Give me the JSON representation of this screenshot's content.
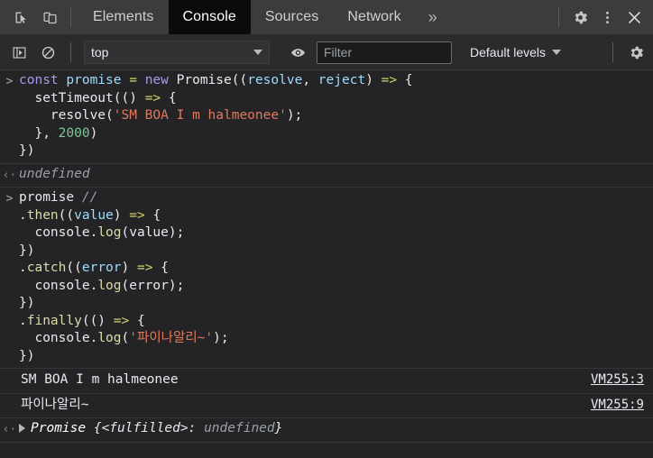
{
  "window": {
    "tabbar": {
      "left_icons": [
        {
          "name": "inspect-element-icon",
          "title": "Inspect element"
        },
        {
          "name": "device-toolbar-icon",
          "title": "Toggle device toolbar"
        }
      ],
      "tabs": [
        {
          "label": "Elements",
          "active": false
        },
        {
          "label": "Console",
          "active": true
        },
        {
          "label": "Sources",
          "active": false
        },
        {
          "label": "Network",
          "active": false
        }
      ],
      "more_tabs_label": "»",
      "right_icons": [
        {
          "name": "settings-gear-icon",
          "title": "Settings"
        },
        {
          "name": "more-options-icon",
          "title": "Customize and control DevTools"
        },
        {
          "name": "close-icon",
          "title": "Close DevTools"
        }
      ]
    },
    "console_toolbar": {
      "sidebar_toggle_title": "Show console sidebar",
      "clear_console_title": "Clear console",
      "context_value": "top",
      "live_expression_title": "Create live expression",
      "filter_placeholder": "Filter",
      "filter_value": "",
      "levels_label": "Default levels",
      "settings_title": "Console settings"
    }
  },
  "console": {
    "entries": [
      {
        "kind": "input",
        "gutter": ">",
        "lines": [
          [
            {
              "t": "const",
              "c": "kw"
            },
            {
              "t": " ",
              "c": "punc"
            },
            {
              "t": "promise",
              "c": "var"
            },
            {
              "t": " ",
              "c": "punc"
            },
            {
              "t": "=",
              "c": "op"
            },
            {
              "t": " ",
              "c": "punc"
            },
            {
              "t": "new",
              "c": "kw"
            },
            {
              "t": " ",
              "c": "punc"
            },
            {
              "t": "Promise",
              "c": "fn"
            },
            {
              "t": "((",
              "c": "punc"
            },
            {
              "t": "resolve",
              "c": "var"
            },
            {
              "t": ", ",
              "c": "punc"
            },
            {
              "t": "reject",
              "c": "var"
            },
            {
              "t": ") ",
              "c": "punc"
            },
            {
              "t": "=>",
              "c": "arrow"
            },
            {
              "t": " {",
              "c": "punc"
            }
          ],
          [
            {
              "t": "  setTimeout(() ",
              "c": "punc"
            },
            {
              "t": "=>",
              "c": "arrow"
            },
            {
              "t": " {",
              "c": "punc"
            }
          ],
          [
            {
              "t": "    resolve(",
              "c": "punc"
            },
            {
              "t": "'SM BOA I m halmeonee'",
              "c": "str"
            },
            {
              "t": ");",
              "c": "punc"
            }
          ],
          [
            {
              "t": "  }, ",
              "c": "punc"
            },
            {
              "t": "2000",
              "c": "num"
            },
            {
              "t": ")",
              "c": "punc"
            }
          ],
          [
            {
              "t": "})",
              "c": "punc"
            }
          ]
        ]
      },
      {
        "kind": "result",
        "gutter": "‹·",
        "lines": [
          [
            {
              "t": "undefined",
              "c": "obj-undef-plain"
            }
          ]
        ]
      },
      {
        "kind": "input",
        "gutter": ">",
        "lines": [
          [
            {
              "t": "promise ",
              "c": "punc"
            },
            {
              "t": "//",
              "c": "cmt"
            }
          ],
          [
            {
              "t": ".",
              "c": "punc"
            },
            {
              "t": "then",
              "c": "meth"
            },
            {
              "t": "((",
              "c": "punc"
            },
            {
              "t": "value",
              "c": "var"
            },
            {
              "t": ") ",
              "c": "punc"
            },
            {
              "t": "=>",
              "c": "arrow"
            },
            {
              "t": " {",
              "c": "punc"
            }
          ],
          [
            {
              "t": "  console.",
              "c": "punc"
            },
            {
              "t": "log",
              "c": "meth"
            },
            {
              "t": "(value);",
              "c": "punc"
            }
          ],
          [
            {
              "t": "})",
              "c": "punc"
            }
          ],
          [
            {
              "t": ".",
              "c": "punc"
            },
            {
              "t": "catch",
              "c": "meth"
            },
            {
              "t": "((",
              "c": "punc"
            },
            {
              "t": "error",
              "c": "var"
            },
            {
              "t": ") ",
              "c": "punc"
            },
            {
              "t": "=>",
              "c": "arrow"
            },
            {
              "t": " {",
              "c": "punc"
            }
          ],
          [
            {
              "t": "  console.",
              "c": "punc"
            },
            {
              "t": "log",
              "c": "meth"
            },
            {
              "t": "(error);",
              "c": "punc"
            }
          ],
          [
            {
              "t": "})",
              "c": "punc"
            }
          ],
          [
            {
              "t": ".",
              "c": "punc"
            },
            {
              "t": "finally",
              "c": "meth"
            },
            {
              "t": "(() ",
              "c": "punc"
            },
            {
              "t": "=>",
              "c": "arrow"
            },
            {
              "t": " {",
              "c": "punc"
            }
          ],
          [
            {
              "t": "  console.",
              "c": "punc"
            },
            {
              "t": "log",
              "c": "meth"
            },
            {
              "t": "(",
              "c": "punc"
            },
            {
              "t": "'파이나알리~'",
              "c": "str"
            },
            {
              "t": ");",
              "c": "punc"
            }
          ],
          [
            {
              "t": "})",
              "c": "punc"
            }
          ]
        ]
      },
      {
        "kind": "log",
        "gutter": "",
        "text": "SM BOA I m halmeonee",
        "link": "VM255:3"
      },
      {
        "kind": "log",
        "gutter": "",
        "text": "파이나알리~",
        "link": "VM255:9"
      },
      {
        "kind": "promise-result",
        "gutter": "‹·",
        "object_name": "Promise",
        "object_open": " {",
        "state": "<fulfilled>",
        "separator": ": ",
        "value": "undefined",
        "object_close": "}"
      }
    ]
  },
  "colors": {
    "background": "#242426",
    "toolbar": "#2b2b2d",
    "tabbar": "#3c3c3e",
    "active_tab": "#0b0b0c",
    "text": "#e8eaed",
    "string": "#e07a5f",
    "keyword": "#a39bf0",
    "variable": "#9cdcfe",
    "method": "#dcdcaa",
    "number": "#7ec699",
    "comment": "#9aa0a6"
  }
}
